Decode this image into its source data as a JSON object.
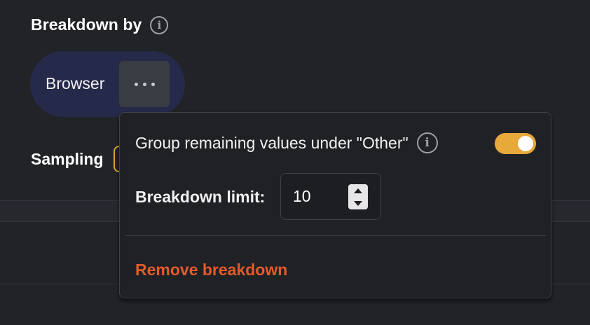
{
  "breakdown": {
    "heading": "Breakdown by",
    "info_icon": "i",
    "pill_label": "Browser",
    "more_icon": "more-horizontal-icon"
  },
  "sampling": {
    "label": "Sampling"
  },
  "popover": {
    "group_other_label": "Group remaining values under \"Other\"",
    "info_icon": "i",
    "group_other_enabled": true,
    "breakdown_limit_label": "Breakdown limit:",
    "breakdown_limit_value": "10",
    "remove_label": "Remove breakdown"
  },
  "colors": {
    "background": "#222327",
    "pill": "#262a4a",
    "toggle_on": "#e7a93a",
    "danger": "#e35b2a"
  }
}
